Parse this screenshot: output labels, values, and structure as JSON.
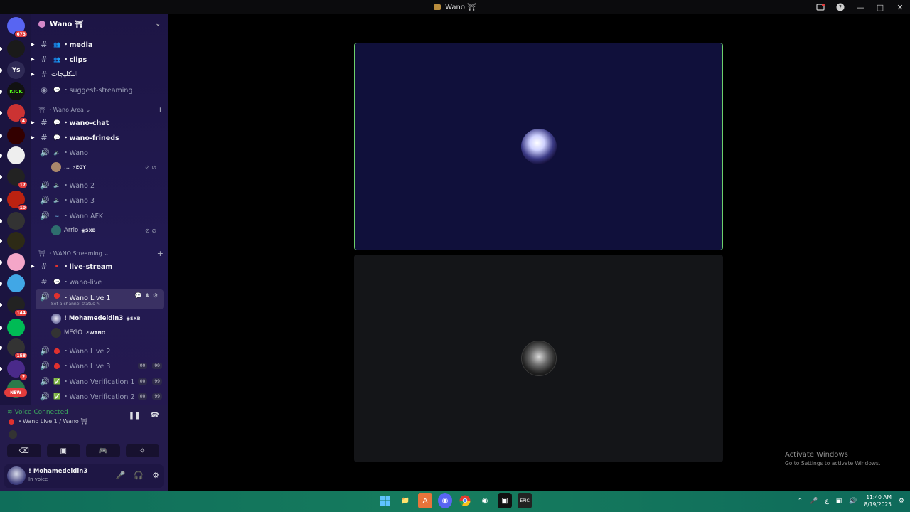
{
  "window": {
    "title": "Wano ⛩"
  },
  "guilds": [
    {
      "name": "home",
      "badge": "673",
      "color": "#5865f2"
    },
    {
      "name": "guild-d",
      "badge": "",
      "color": "#1a1a1a"
    },
    {
      "name": "Ys",
      "badge": "",
      "color": "#2f2a55"
    },
    {
      "name": "KICK",
      "badge": "",
      "color": "#111"
    },
    {
      "name": "guild-m",
      "badge": "4",
      "color": "#c33"
    },
    {
      "name": "guild-red",
      "badge": "",
      "color": "#300"
    },
    {
      "name": "guild-white",
      "badge": "",
      "color": "#eee"
    },
    {
      "name": "guild-skull",
      "badge": "17",
      "color": "#222"
    },
    {
      "name": "guild-tk",
      "badge": "10",
      "color": "#b21"
    },
    {
      "name": "guild-sxb",
      "badge": "",
      "color": "#333"
    },
    {
      "name": "guild-wano",
      "badge": "",
      "color": "#2d2a16"
    },
    {
      "name": "guild-kirby",
      "badge": "",
      "color": "#f4a6c8"
    },
    {
      "name": "guild-blue",
      "badge": "",
      "color": "#41a7e6"
    },
    {
      "name": "guild-144",
      "badge": "144",
      "color": "#222"
    },
    {
      "name": "guild-tkq",
      "badge": "",
      "color": "#0b5"
    },
    {
      "name": "guild-158",
      "badge": "158",
      "color": "#333"
    },
    {
      "name": "guild-2",
      "badge": "2",
      "color": "#4a2a8a"
    },
    {
      "name": "guild-new",
      "badge": "NEW",
      "color": "#2a7a4a"
    }
  ],
  "server": {
    "name": "Wano ⛩"
  },
  "channels": {
    "media": "・media",
    "clips": "・clips",
    "clips_ar": "التكليجات",
    "suggest": "・suggest-streaming",
    "cat_area": "・Wano Area",
    "wano_chat": "・wano-chat",
    "wano_frineds": "・wano-frineds",
    "wano": "・Wano",
    "wano_user_name": "...",
    "wano_user_tag": "EGY",
    "wano2": "・Wano 2",
    "wano3": "・Wano 3",
    "wano_afk": "・Wano AFK",
    "afk_user_name": "Arrio",
    "afk_user_tag": "SXB",
    "cat_streaming": "・WANO Streaming",
    "live_stream": "・live-stream",
    "wano_live": "・wano-live",
    "wano_live1": "・Wano Live 1",
    "set_status": "Set a channel status ✎",
    "live1_user1": "! Mohamedeldin3",
    "live1_user1_tag": "SXB",
    "live1_user2": "MEGO",
    "live1_user2_tag": "WANO",
    "wano_live2": "・Wano Live 2",
    "wano_live3": "・Wano Live 3",
    "wano_ver1": "・Wano Verification 1",
    "wano_ver2": "・Wano Verification 2",
    "cnt_a": "00",
    "cnt_b": "99"
  },
  "voice": {
    "status": "Voice Connected",
    "location": "・Wano Live 1 / Wano ⛩"
  },
  "user": {
    "name": "! Mohamedeldin3",
    "status": "In voice"
  },
  "watermark": {
    "line1": "Activate Windows",
    "line2": "Go to Settings to activate Windows."
  },
  "taskbar": {
    "time": "11:40 AM",
    "date": "8/19/2025",
    "lang": "ع"
  },
  "colors": {
    "speaking_border": "#6cd06b",
    "connected": "#3ba55d",
    "badge": "#e23c3c"
  }
}
